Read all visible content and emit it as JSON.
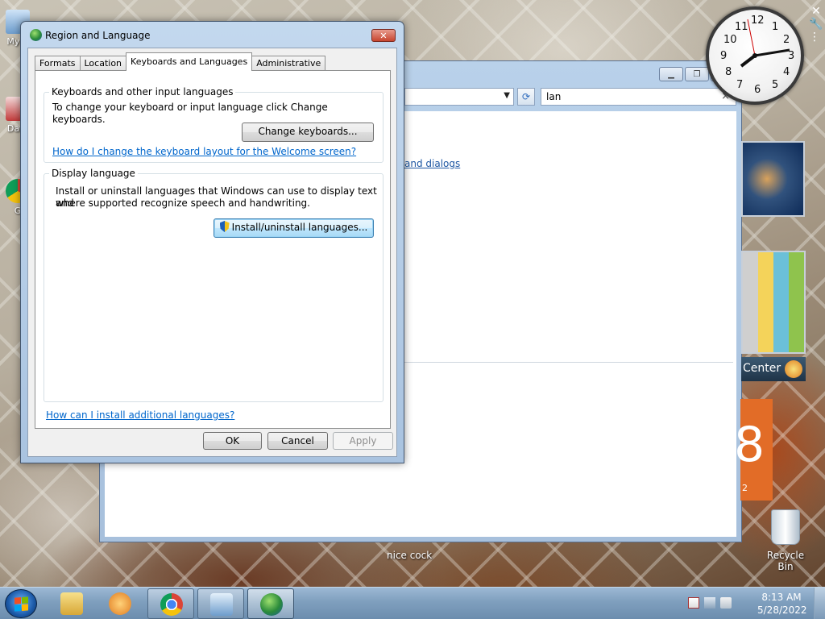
{
  "desktop": {
    "left_icons": [
      {
        "label": "My C"
      },
      {
        "label": "Data"
      },
      {
        "label": "G"
      }
    ],
    "item_label": "nice cock",
    "recycle_bin": "Recycle Bin"
  },
  "background_window": {
    "search_value": "lan",
    "link_fragment": "and dialogs"
  },
  "gadgets": {
    "clock_numbers": [
      "12",
      "1",
      "2",
      "3",
      "4",
      "5",
      "6",
      "7",
      "8",
      "9",
      "10",
      "11"
    ],
    "center_text": "Center",
    "calendar_digit": "8",
    "calendar_small": "2"
  },
  "dialog": {
    "title": "Region and Language",
    "tabs": [
      {
        "label": "Formats"
      },
      {
        "label": "Location"
      },
      {
        "label": "Keyboards and Languages",
        "active": true
      },
      {
        "label": "Administrative"
      }
    ],
    "keyboards_group": {
      "legend": "Keyboards and other input languages",
      "description": "To change your keyboard or input language click Change keyboards.",
      "button": "Change keyboards...",
      "link": "How do I change the keyboard layout for the Welcome screen?"
    },
    "display_group": {
      "legend": "Display language",
      "description_line1": "Install or uninstall languages that Windows can use to display text and",
      "description_line2": "where supported recognize speech and handwriting.",
      "button": "Install/uninstall languages..."
    },
    "bottom_link": "How can I install additional languages?",
    "buttons": {
      "ok": "OK",
      "cancel": "Cancel",
      "apply": "Apply"
    }
  },
  "taskbar": {
    "time": "8:13 AM",
    "date": "5/28/2022"
  }
}
